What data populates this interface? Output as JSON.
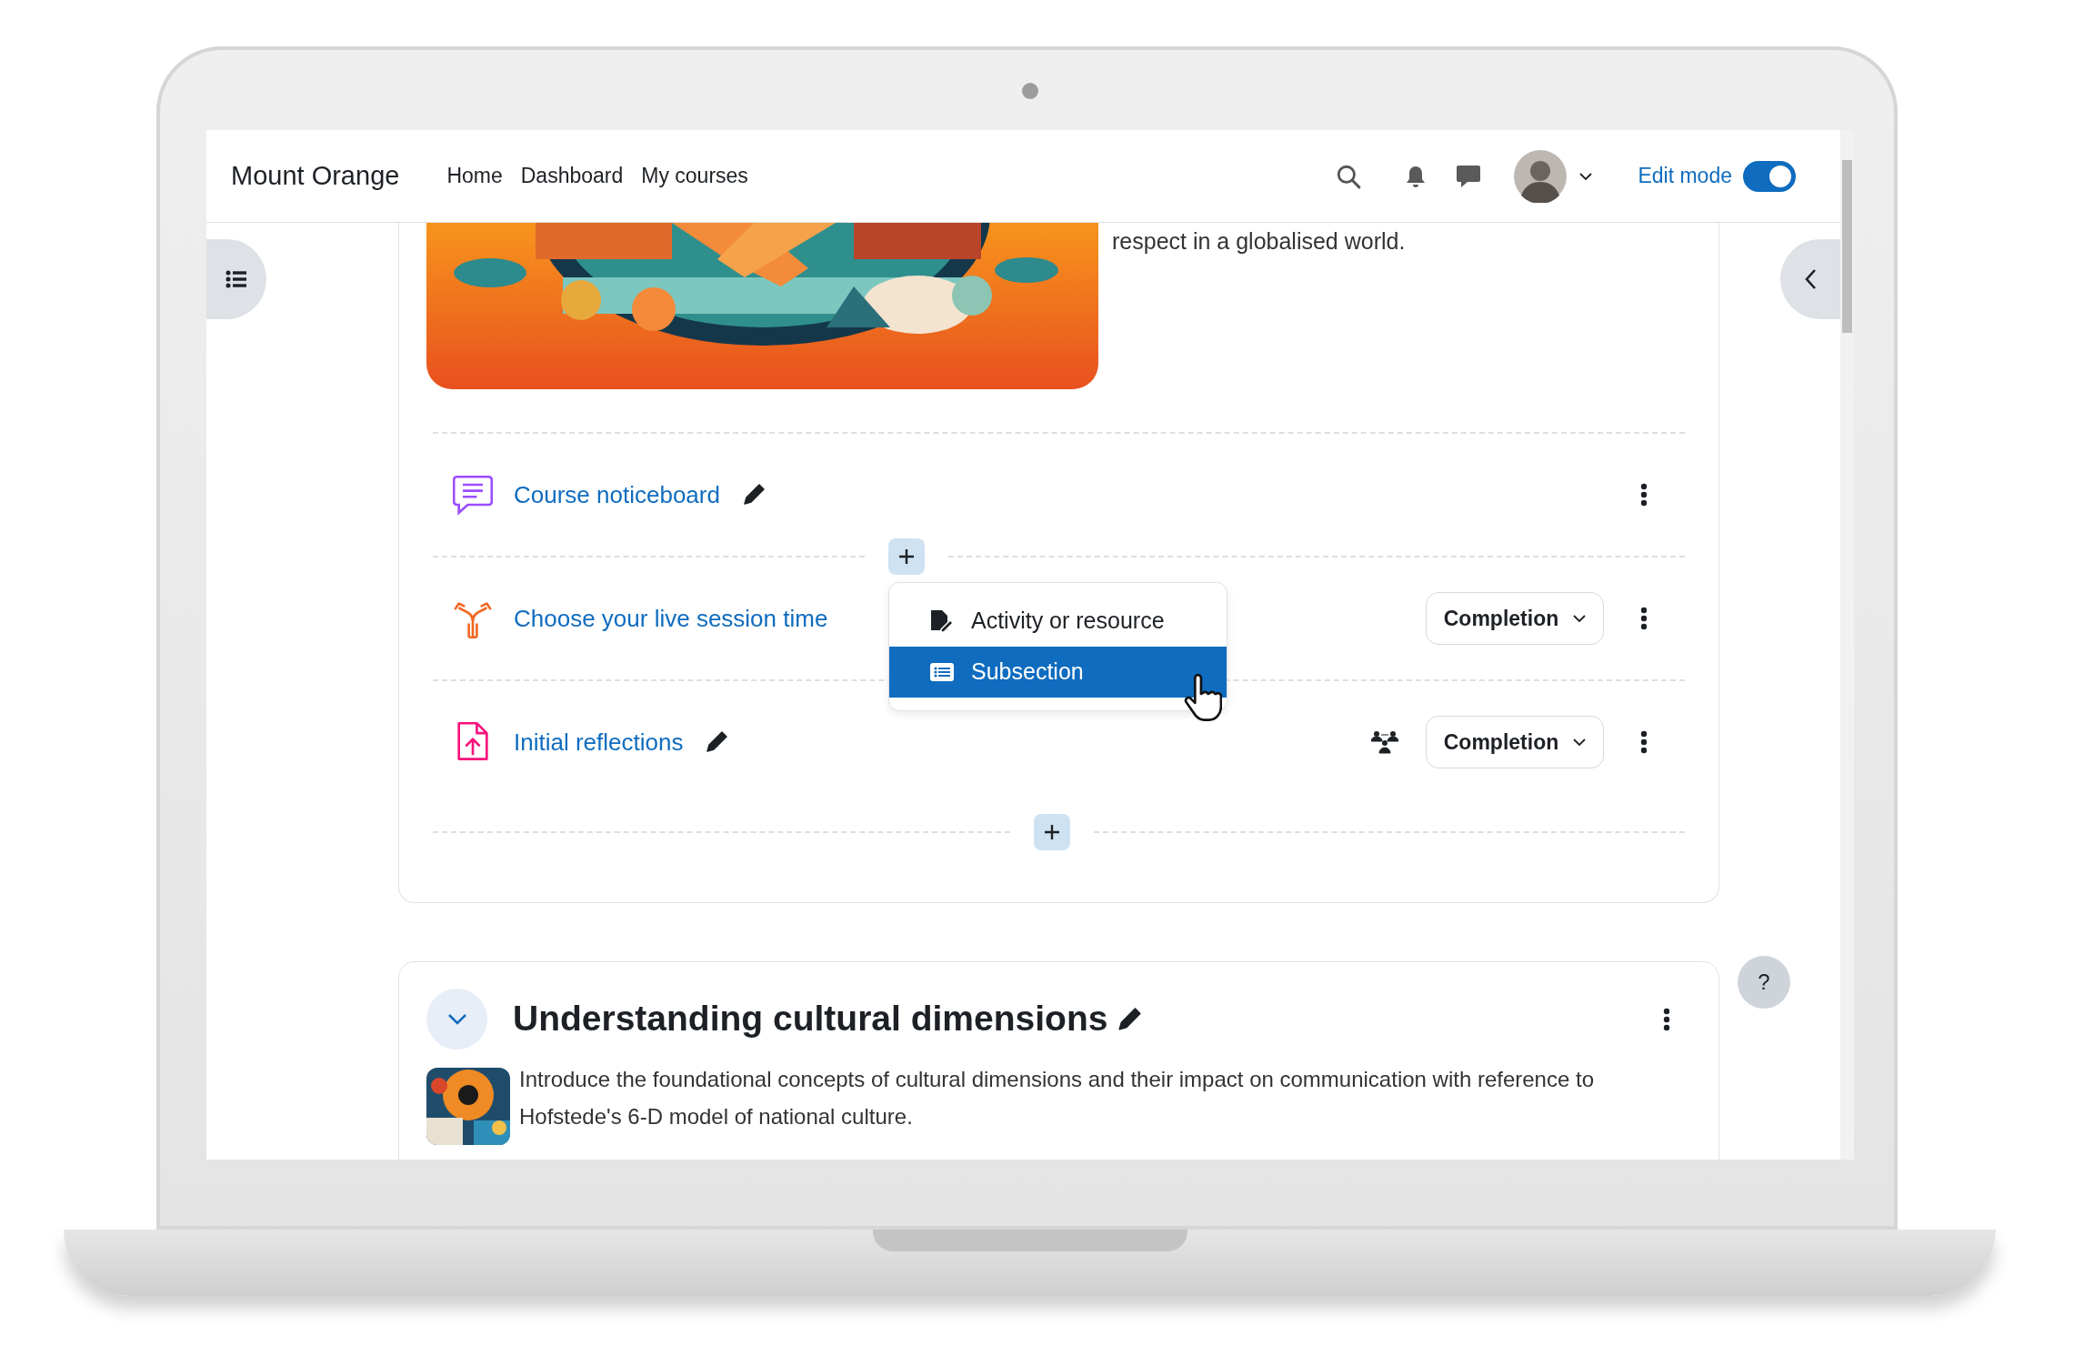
{
  "navbar": {
    "brand": "Mount Orange",
    "links": [
      "Home",
      "Dashboard",
      "My courses"
    ],
    "edit_mode": {
      "label": "Edit mode",
      "on": true
    }
  },
  "intro": {
    "text": "respect in a globalised world."
  },
  "activities": [
    {
      "kind": "forum",
      "title": "Course noticeboard",
      "editable": true,
      "group_mode": false
    },
    {
      "kind": "choice",
      "title": "Choose your live session time",
      "editable": false,
      "group_mode": false,
      "completion": "Completion"
    },
    {
      "kind": "assignment",
      "title": "Initial reflections",
      "editable": true,
      "group_mode": true,
      "completion": "Completion"
    }
  ],
  "add_menu": {
    "items": [
      {
        "kind": "activity",
        "label": "Activity or resource",
        "selected": false
      },
      {
        "kind": "subsection",
        "label": "Subsection",
        "selected": true
      }
    ]
  },
  "section": {
    "title": "Understanding cultural dimensions",
    "expanded": true,
    "editable": true,
    "summary": "Introduce the foundational concepts of cultural dimensions and their impact on communication with reference to Hofstede's 6-D model of national culture."
  },
  "help_button": "?"
}
